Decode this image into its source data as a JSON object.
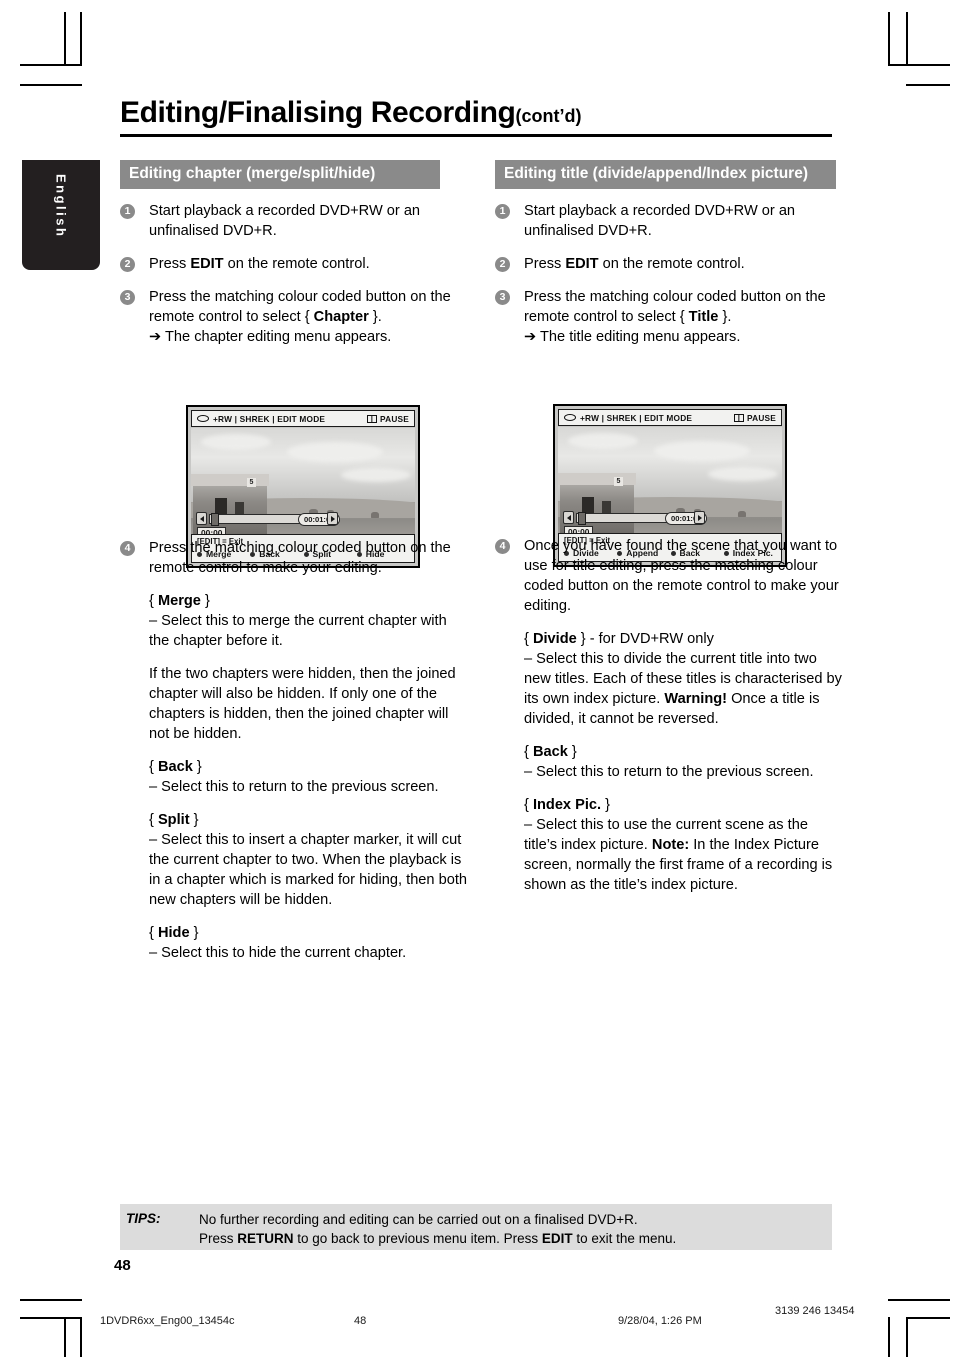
{
  "language_tab": {
    "label": "English"
  },
  "header": {
    "title_main": "Editing/Finalising Recording",
    "title_suffix": "(cont’d)"
  },
  "left_column": {
    "section_heading": "Editing chapter (merge/split/hide)",
    "steps": [
      {
        "num": "1",
        "text": "Start playback a recorded DVD+RW or an unfinalised DVD+R."
      },
      {
        "num": "2",
        "text_pre": "Press ",
        "bold": "EDIT",
        "text_post": " on the remote control."
      },
      {
        "num": "3",
        "text_pre": "Press the matching colour coded button on the remote control to select { ",
        "bold": "Chapter",
        "text_post": " }.",
        "result": "➔ The chapter editing menu appears."
      },
      {
        "num": "4",
        "text": "Press the matching colour coded button on the remote control to make your editing."
      }
    ],
    "options": [
      {
        "title_open": "{ ",
        "title": "Merge",
        "title_close": " }",
        "body": "–  Select this to merge the current chapter with the chapter before it."
      },
      {
        "body": "If the two chapters were hidden, then the joined chapter will also be hidden.  If only one of the chapters is hidden, then the joined chapter will not be hidden."
      },
      {
        "title_open": "{ ",
        "title": "Back",
        "title_close": " }",
        "body": "–  Select this to return to the previous screen."
      },
      {
        "title_open": "{ ",
        "title": "Split",
        "title_close": " }",
        "body": "–  Select this to insert a chapter marker, it will cut the current chapter to two. When the playback is in a chapter which is marked for hiding, then both new chapters will be hidden."
      },
      {
        "title_open": "{ ",
        "title": "Hide",
        "title_close": " }",
        "body": "–  Select this to hide the current chapter."
      }
    ],
    "tv_screen": {
      "status_bar": "+RW | SHREK | EDIT MODE",
      "status_right": "PAUSE",
      "disc_icon": "disc-icon",
      "pause_icon": "pause-icon",
      "elapsed_time": "00:00",
      "total_time": "00:01:02",
      "exit_hint": "[EDIT] = Exit",
      "keys": [
        "Merge",
        "Back",
        "Split",
        "Hide"
      ]
    }
  },
  "right_column": {
    "section_heading": "Editing title (divide/append/Index picture)",
    "steps": [
      {
        "num": "1",
        "text": "Start playback a recorded DVD+RW or an unfinalised DVD+R."
      },
      {
        "num": "2",
        "text_pre": "Press ",
        "bold": "EDIT",
        "text_post": " on the remote control."
      },
      {
        "num": "3",
        "text_pre": "Press the matching colour coded button on the remote control to select { ",
        "bold": "Title",
        "text_post": " }.",
        "result": "➔ The title editing menu appears."
      },
      {
        "num": "4",
        "text": "Once you have found the scene that you want to use for title editing, press the matching colour coded button on the remote control to make your editing."
      }
    ],
    "options": [
      {
        "title_open": "{ ",
        "title": "Divide",
        "title_close": " } - for DVD+RW only",
        "body": "–  Select this to divide the current title into two new titles.  Each of these titles is characterised by its own index picture. ",
        "bold_lead": "Warning!",
        "body2": " Once a title is divided, it cannot be reversed."
      },
      {
        "title_open": "{ ",
        "title": "Back",
        "title_close": " }",
        "body": "–  Select this to return to the previous screen."
      },
      {
        "title_open": "{ ",
        "title": "Index Pic.",
        "title_close": " }",
        "body": "–  Select this to use the current scene as the title’s index picture. ",
        "bold_lead": "Note:",
        "body2": "  In the Index Picture screen, normally the first frame of a recording is shown as the title’s index picture."
      }
    ],
    "tv_screen": {
      "status_bar": "+RW | SHREK | EDIT MODE",
      "status_right": "PAUSE",
      "disc_icon": "disc-icon",
      "pause_icon": "pause-icon",
      "elapsed_time": "00:00",
      "total_time": "00:01:02",
      "exit_hint": "[EDIT] = Exit",
      "keys": [
        "Divide",
        "Append",
        "Back",
        "Index Pic."
      ]
    }
  },
  "tips": {
    "label": "TIPS:",
    "line1": "No further recording and editing can be carried out on a finalised DVD+R.",
    "line2_pre": "Press ",
    "line2_b1": "RETURN",
    "line2_mid": " to go back to previous menu item.  Press ",
    "line2_b2": "EDIT",
    "line2_post": " to exit the menu."
  },
  "page_number": "48",
  "print_footer": {
    "file": "1DVDR6xx_Eng00_13454c",
    "page": "48",
    "date": "9/28/04, 1:26 PM",
    "code": "3139 246 13454"
  }
}
